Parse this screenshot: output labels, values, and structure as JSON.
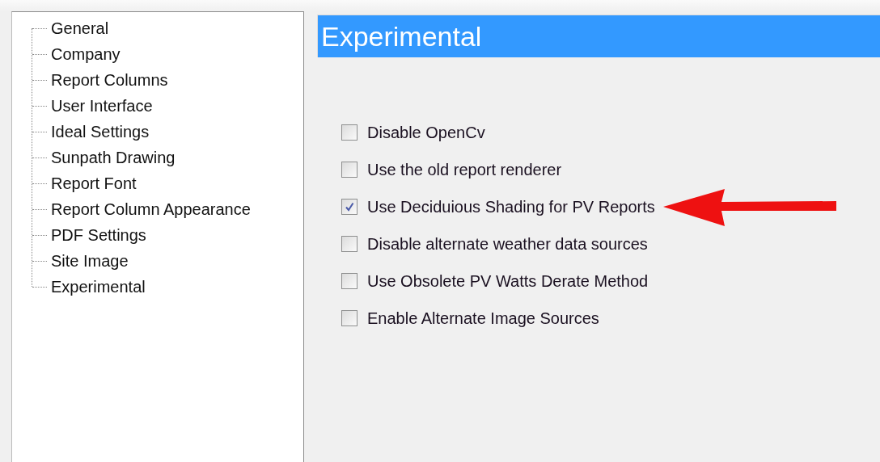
{
  "tree": {
    "items": [
      {
        "label": "General",
        "selected": false
      },
      {
        "label": "Company",
        "selected": false
      },
      {
        "label": "Report Columns",
        "selected": false
      },
      {
        "label": "User Interface",
        "selected": false
      },
      {
        "label": "Ideal Settings",
        "selected": false
      },
      {
        "label": "Sunpath Drawing",
        "selected": false
      },
      {
        "label": "Report Font",
        "selected": false
      },
      {
        "label": "Report Column Appearance",
        "selected": false
      },
      {
        "label": "PDF Settings",
        "selected": false
      },
      {
        "label": "Site Image",
        "selected": false
      },
      {
        "label": "Experimental",
        "selected": false
      }
    ]
  },
  "panel": {
    "title": "Experimental",
    "options": [
      {
        "label": "Disable OpenCv",
        "checked": false
      },
      {
        "label": "Use the old report renderer",
        "checked": false
      },
      {
        "label": "Use Deciduious Shading for PV Reports",
        "checked": true
      },
      {
        "label": "Disable alternate weather data sources",
        "checked": false
      },
      {
        "label": "Use Obsolete PV Watts Derate Method",
        "checked": false
      },
      {
        "label": "Enable Alternate Image Sources",
        "checked": false
      }
    ]
  }
}
